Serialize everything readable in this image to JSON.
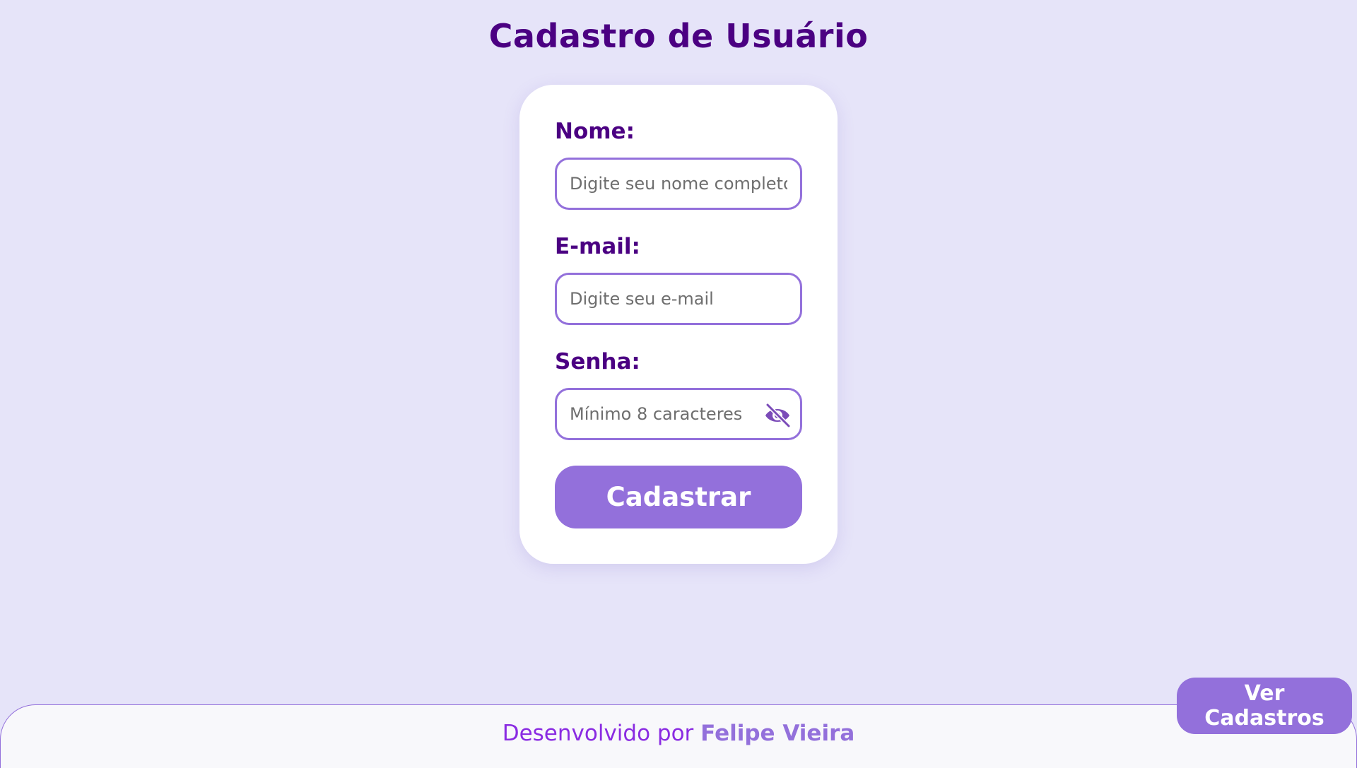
{
  "page": {
    "title": "Cadastro de Usuário"
  },
  "form": {
    "name": {
      "label": "Nome:",
      "placeholder": "Digite seu nome completo",
      "value": ""
    },
    "email": {
      "label": "E-mail:",
      "placeholder": "Digite seu e-mail",
      "value": ""
    },
    "password": {
      "label": "Senha:",
      "placeholder": "Mínimo 8 caracteres",
      "value": "",
      "toggle_icon": "eye-slash-icon"
    },
    "submit_label": "Cadastrar"
  },
  "footer": {
    "prefix": "Desenvolvido por",
    "author": "Felipe Vieira"
  },
  "view_button_label": "Ver Cadastros",
  "colors": {
    "background": "#e6e4f9",
    "accent": "#9370db",
    "heading": "#4b0082",
    "footer_text": "#8a2be2"
  }
}
